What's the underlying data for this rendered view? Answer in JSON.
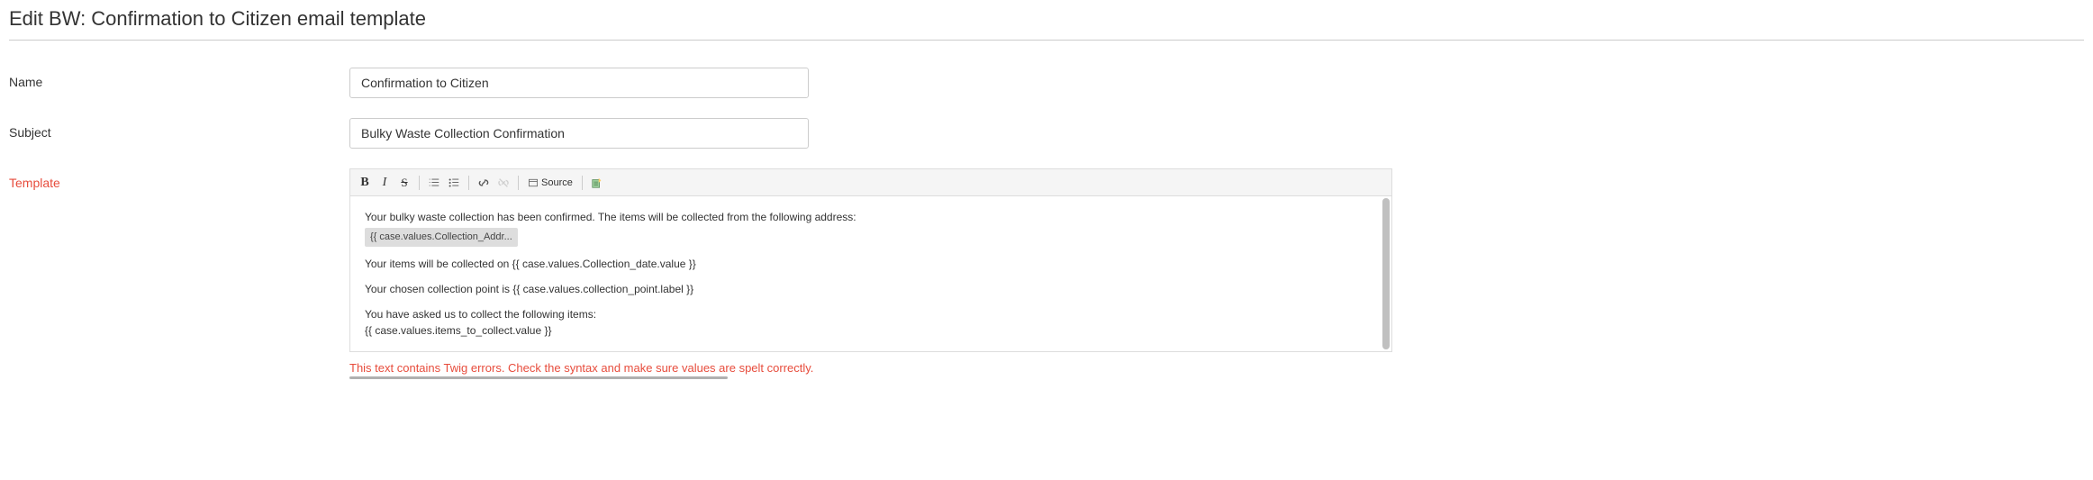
{
  "page": {
    "title": "Edit BW: Confirmation to Citizen email template"
  },
  "form": {
    "name": {
      "label": "Name",
      "value": "Confirmation to Citizen"
    },
    "subject": {
      "label": "Subject",
      "value": "Bulky Waste Collection Confirmation"
    },
    "template": {
      "label": "Template",
      "error": "This text contains Twig errors. Check the syntax and make sure values are spelt correctly."
    }
  },
  "toolbar": {
    "source_label": "Source"
  },
  "editor": {
    "line1": "Your bulky waste collection has been confirmed. The items will be collected from the following address:",
    "chip1": "{{ case.values.Collection_Addr...",
    "line2": "Your items will be collected on {{ case.values.Collection_date.value }}",
    "line3": "Your chosen collection point is {{ case.values.collection_point.label }}",
    "line4": "You have asked us to collect the following items:",
    "line5": "{{ case.values.items_to_collect.value }}"
  }
}
